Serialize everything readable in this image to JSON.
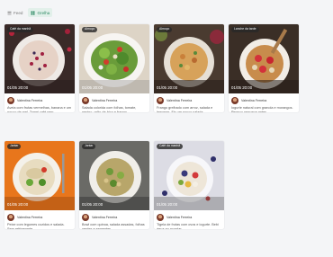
{
  "tabs": [
    {
      "label": "Feed",
      "icon": "feed-icon",
      "active": false
    },
    {
      "label": "Grelha",
      "icon": "grid-icon",
      "active": true
    }
  ],
  "posts": [
    {
      "badge": "Café da manhã",
      "date": "01/05 20:00",
      "author": "Valentina Ferreira",
      "text": "Aveia com frutas vermelhas, banana e um pouco de mel. Tomei café sem...",
      "comments_count": "2",
      "image": "oatmeal-berries"
    },
    {
      "badge": "Almoço",
      "date": "01/05 20:00",
      "author": "Valentina Ferreira",
      "text": "Salada colorida com folhas, tomate, pepino, grão-de-bico e frango...",
      "comments_count": "",
      "image": "green-salad"
    },
    {
      "badge": "Almoço",
      "date": "01/05 20:00",
      "author": "Valentina Ferreira",
      "text": "Frango grelhado com arroz, salada e legumes. Fiz um pouco salada...",
      "comments_count": "",
      "image": "rice-chicken"
    },
    {
      "badge": "Lanche da tarde",
      "date": "01/05 20:00",
      "author": "Valentina Ferreira",
      "text": "Iogurte natural com granola e morangos. Pensou pequena antes...",
      "comments_count": "2",
      "image": "yogurt-strawberries"
    },
    {
      "badge": "Jantar",
      "date": "01/05 20:00",
      "author": "Valentina Ferreira",
      "text": "Peixe com legumes cozidos e salada. Sem refrigerante.",
      "comments_count": "",
      "image": "fish-vegetables"
    },
    {
      "badge": "Jantar",
      "date": "01/05 20:00",
      "author": "Valentina Ferreira",
      "text": "Bowl com quinoa, salada assadas, folhas verdes e sementes.",
      "comments_count": "2",
      "image": "quinoa-bowl"
    },
    {
      "badge": "Café da manhã",
      "date": "01/05 20:00",
      "author": "Valentina Ferreira",
      "text": "Tigela de frutas com ovos e iogurte. Bebi água ao acordar.",
      "comments_count": "",
      "image": "fruit-bowl"
    }
  ]
}
